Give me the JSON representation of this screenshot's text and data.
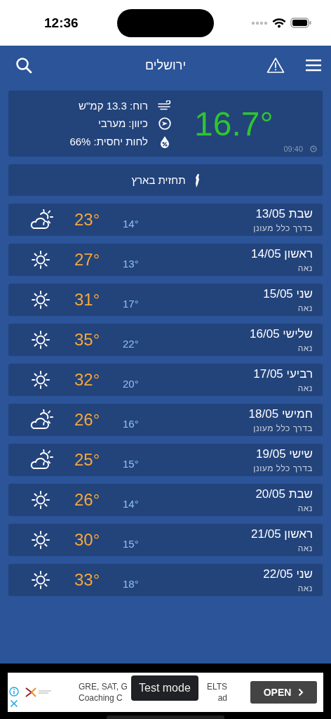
{
  "status_bar": {
    "time": "12:36"
  },
  "header": {
    "title": "ירושלים"
  },
  "current": {
    "temperature": "16.7°",
    "time": "09:40",
    "details": [
      {
        "kind": "wind",
        "text": "רוח: 13.3 קמ\"ש"
      },
      {
        "kind": "direction",
        "text": "כיוון: מערבי"
      },
      {
        "kind": "humidity",
        "text": "לחות יחסית: 66%"
      }
    ]
  },
  "country_forecast": {
    "label": "תחזית בארץ"
  },
  "forecast": [
    {
      "day": "שבת 13/05",
      "description": "בדרך כלל מעונן",
      "high": "23°",
      "low": "14°",
      "kind": "cloudy"
    },
    {
      "day": "ראשון 14/05",
      "description": "נאה",
      "high": "27°",
      "low": "13°",
      "kind": "sunny"
    },
    {
      "day": "שני 15/05",
      "description": "נאה",
      "high": "31°",
      "low": "17°",
      "kind": "sunny"
    },
    {
      "day": "שלישי 16/05",
      "description": "נאה",
      "high": "35°",
      "low": "22°",
      "kind": "sunny"
    },
    {
      "day": "רביעי 17/05",
      "description": "נאה",
      "high": "32°",
      "low": "20°",
      "kind": "sunny"
    },
    {
      "day": "חמישי 18/05",
      "description": "בדרך כלל מעונן",
      "high": "26°",
      "low": "16°",
      "kind": "cloudy"
    },
    {
      "day": "שישי 19/05",
      "description": "בדרך כלל מעונן",
      "high": "25°",
      "low": "15°",
      "kind": "cloudy"
    },
    {
      "day": "שבת 20/05",
      "description": "נאה",
      "high": "26°",
      "low": "14°",
      "kind": "sunny"
    },
    {
      "day": "ראשון 21/05",
      "description": "נאה",
      "high": "30°",
      "low": "15°",
      "kind": "sunny"
    },
    {
      "day": "שני 22/05",
      "description": "נאה",
      "high": "33°",
      "low": "18°",
      "kind": "sunny"
    }
  ],
  "ad": {
    "line_1_start": "GRE, SAT, G",
    "line_1_end": "ELTS",
    "line_2_start": "Coaching C",
    "line_2_end": "ad",
    "button": "OPEN",
    "toast": "Test mode"
  }
}
